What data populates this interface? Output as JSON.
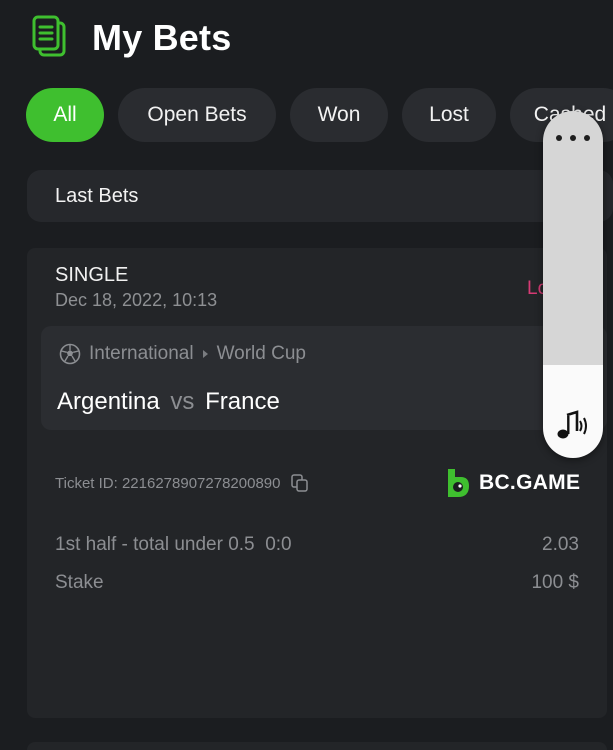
{
  "header": {
    "title": "My Bets",
    "icon": "receipt-icon"
  },
  "tabs": [
    {
      "label": "All",
      "active": true
    },
    {
      "label": "Open Bets",
      "active": false
    },
    {
      "label": "Won",
      "active": false
    },
    {
      "label": "Lost",
      "active": false
    },
    {
      "label": "Cashed",
      "active": false
    }
  ],
  "filter": {
    "label": "Last Bets"
  },
  "bet": {
    "type": "SINGLE",
    "date": "Dec 18, 2022, 10:13",
    "status": "Lost",
    "league": {
      "category": "International",
      "tournament": "World Cup"
    },
    "teams": {
      "home": "Argentina",
      "vs": "vs",
      "away": "France"
    },
    "ticket_label": "Ticket ID:",
    "ticket_id": "2216278907278200890",
    "brand": "BC.GAME",
    "selection": {
      "market": "1st half - total under 0.5",
      "score": "0:0",
      "odds": "2.03"
    },
    "stake": {
      "label": "Stake",
      "value": "100 $"
    }
  },
  "overlay": {
    "menu_icon": "more-dots-icon",
    "sound_icon": "sound-icon"
  },
  "colors": {
    "accent": "#3fbf2f",
    "lost": "#d63a74",
    "background": "#1b1d20",
    "card": "#232528"
  }
}
